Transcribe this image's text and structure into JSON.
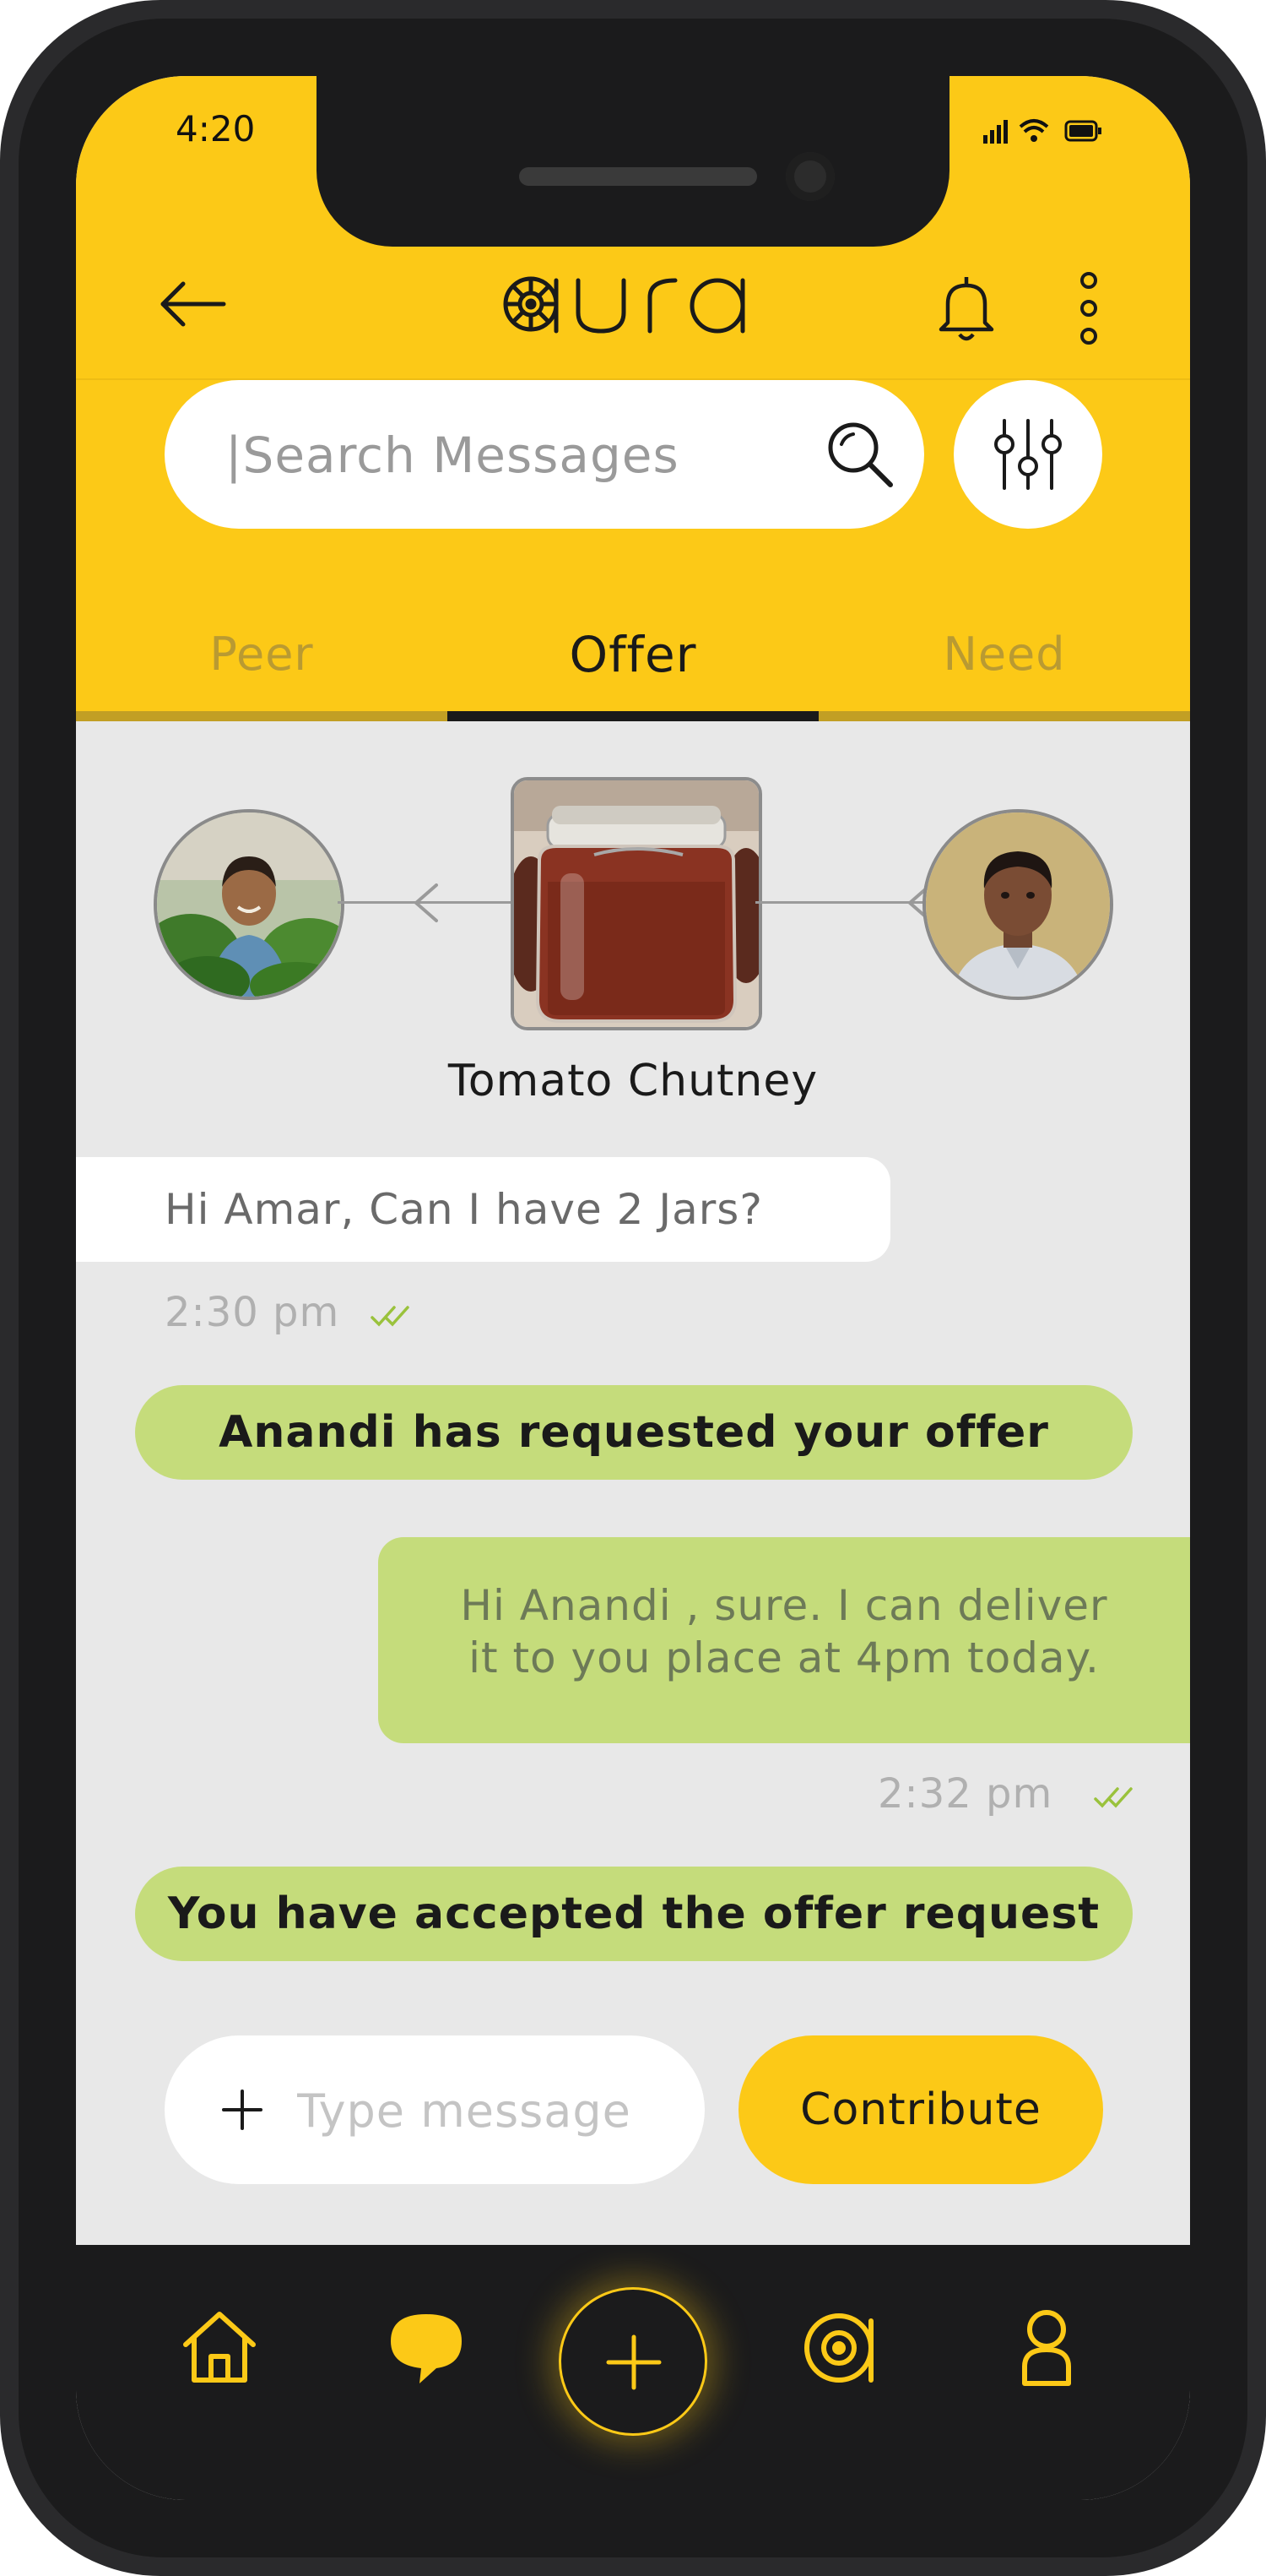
{
  "status": {
    "time": "4:20"
  },
  "header": {
    "back_icon": "arrow-left-icon",
    "logo": "aura",
    "bell_icon": "bell-icon",
    "menu_icon": "more-vertical-icon"
  },
  "search": {
    "placeholder": "|Search Messages",
    "search_icon": "search-icon",
    "filter_icon": "sliders-icon"
  },
  "tabs": [
    {
      "label": "Peer",
      "active": false
    },
    {
      "label": "Offer",
      "active": true
    },
    {
      "label": "Need",
      "active": false
    }
  ],
  "offer": {
    "product_name": "Tomato Chutney"
  },
  "messages": {
    "incoming": {
      "text": "Hi Amar, Can I have 2 Jars?",
      "time": "2:30 pm"
    },
    "system_1": "Anandi has requested your offer",
    "outgoing": {
      "line1": "Hi Anandi , sure. I can deliver",
      "line2": "it to you place at 4pm today.",
      "time": "2:32 pm"
    },
    "system_2": "You have accepted the offer request"
  },
  "composer": {
    "placeholder": "Type message",
    "button_label": "Contribute"
  },
  "colors": {
    "brand_yellow": "#fcc917",
    "bubble_green": "#c5dc7b",
    "tick_green": "#9ac23c",
    "nav_dark": "#1b1b1c"
  },
  "nav": [
    "home-icon",
    "chat-icon",
    "add-icon",
    "aura-icon",
    "profile-icon"
  ]
}
